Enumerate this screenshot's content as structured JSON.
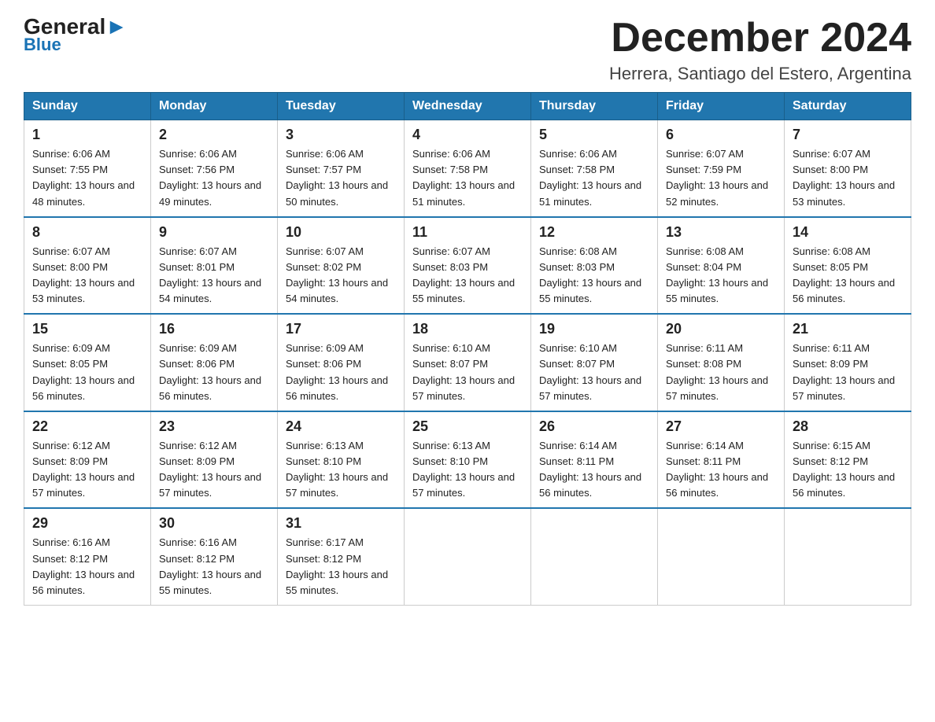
{
  "logo": {
    "general": "General",
    "blue": "Blue"
  },
  "title": "December 2024",
  "location": "Herrera, Santiago del Estero, Argentina",
  "headers": [
    "Sunday",
    "Monday",
    "Tuesday",
    "Wednesday",
    "Thursday",
    "Friday",
    "Saturday"
  ],
  "weeks": [
    [
      {
        "day": "1",
        "sunrise": "6:06 AM",
        "sunset": "7:55 PM",
        "daylight": "13 hours and 48 minutes."
      },
      {
        "day": "2",
        "sunrise": "6:06 AM",
        "sunset": "7:56 PM",
        "daylight": "13 hours and 49 minutes."
      },
      {
        "day": "3",
        "sunrise": "6:06 AM",
        "sunset": "7:57 PM",
        "daylight": "13 hours and 50 minutes."
      },
      {
        "day": "4",
        "sunrise": "6:06 AM",
        "sunset": "7:58 PM",
        "daylight": "13 hours and 51 minutes."
      },
      {
        "day": "5",
        "sunrise": "6:06 AM",
        "sunset": "7:58 PM",
        "daylight": "13 hours and 51 minutes."
      },
      {
        "day": "6",
        "sunrise": "6:07 AM",
        "sunset": "7:59 PM",
        "daylight": "13 hours and 52 minutes."
      },
      {
        "day": "7",
        "sunrise": "6:07 AM",
        "sunset": "8:00 PM",
        "daylight": "13 hours and 53 minutes."
      }
    ],
    [
      {
        "day": "8",
        "sunrise": "6:07 AM",
        "sunset": "8:00 PM",
        "daylight": "13 hours and 53 minutes."
      },
      {
        "day": "9",
        "sunrise": "6:07 AM",
        "sunset": "8:01 PM",
        "daylight": "13 hours and 54 minutes."
      },
      {
        "day": "10",
        "sunrise": "6:07 AM",
        "sunset": "8:02 PM",
        "daylight": "13 hours and 54 minutes."
      },
      {
        "day": "11",
        "sunrise": "6:07 AM",
        "sunset": "8:03 PM",
        "daylight": "13 hours and 55 minutes."
      },
      {
        "day": "12",
        "sunrise": "6:08 AM",
        "sunset": "8:03 PM",
        "daylight": "13 hours and 55 minutes."
      },
      {
        "day": "13",
        "sunrise": "6:08 AM",
        "sunset": "8:04 PM",
        "daylight": "13 hours and 55 minutes."
      },
      {
        "day": "14",
        "sunrise": "6:08 AM",
        "sunset": "8:05 PM",
        "daylight": "13 hours and 56 minutes."
      }
    ],
    [
      {
        "day": "15",
        "sunrise": "6:09 AM",
        "sunset": "8:05 PM",
        "daylight": "13 hours and 56 minutes."
      },
      {
        "day": "16",
        "sunrise": "6:09 AM",
        "sunset": "8:06 PM",
        "daylight": "13 hours and 56 minutes."
      },
      {
        "day": "17",
        "sunrise": "6:09 AM",
        "sunset": "8:06 PM",
        "daylight": "13 hours and 56 minutes."
      },
      {
        "day": "18",
        "sunrise": "6:10 AM",
        "sunset": "8:07 PM",
        "daylight": "13 hours and 57 minutes."
      },
      {
        "day": "19",
        "sunrise": "6:10 AM",
        "sunset": "8:07 PM",
        "daylight": "13 hours and 57 minutes."
      },
      {
        "day": "20",
        "sunrise": "6:11 AM",
        "sunset": "8:08 PM",
        "daylight": "13 hours and 57 minutes."
      },
      {
        "day": "21",
        "sunrise": "6:11 AM",
        "sunset": "8:09 PM",
        "daylight": "13 hours and 57 minutes."
      }
    ],
    [
      {
        "day": "22",
        "sunrise": "6:12 AM",
        "sunset": "8:09 PM",
        "daylight": "13 hours and 57 minutes."
      },
      {
        "day": "23",
        "sunrise": "6:12 AM",
        "sunset": "8:09 PM",
        "daylight": "13 hours and 57 minutes."
      },
      {
        "day": "24",
        "sunrise": "6:13 AM",
        "sunset": "8:10 PM",
        "daylight": "13 hours and 57 minutes."
      },
      {
        "day": "25",
        "sunrise": "6:13 AM",
        "sunset": "8:10 PM",
        "daylight": "13 hours and 57 minutes."
      },
      {
        "day": "26",
        "sunrise": "6:14 AM",
        "sunset": "8:11 PM",
        "daylight": "13 hours and 56 minutes."
      },
      {
        "day": "27",
        "sunrise": "6:14 AM",
        "sunset": "8:11 PM",
        "daylight": "13 hours and 56 minutes."
      },
      {
        "day": "28",
        "sunrise": "6:15 AM",
        "sunset": "8:12 PM",
        "daylight": "13 hours and 56 minutes."
      }
    ],
    [
      {
        "day": "29",
        "sunrise": "6:16 AM",
        "sunset": "8:12 PM",
        "daylight": "13 hours and 56 minutes."
      },
      {
        "day": "30",
        "sunrise": "6:16 AM",
        "sunset": "8:12 PM",
        "daylight": "13 hours and 55 minutes."
      },
      {
        "day": "31",
        "sunrise": "6:17 AM",
        "sunset": "8:12 PM",
        "daylight": "13 hours and 55 minutes."
      },
      null,
      null,
      null,
      null
    ]
  ]
}
